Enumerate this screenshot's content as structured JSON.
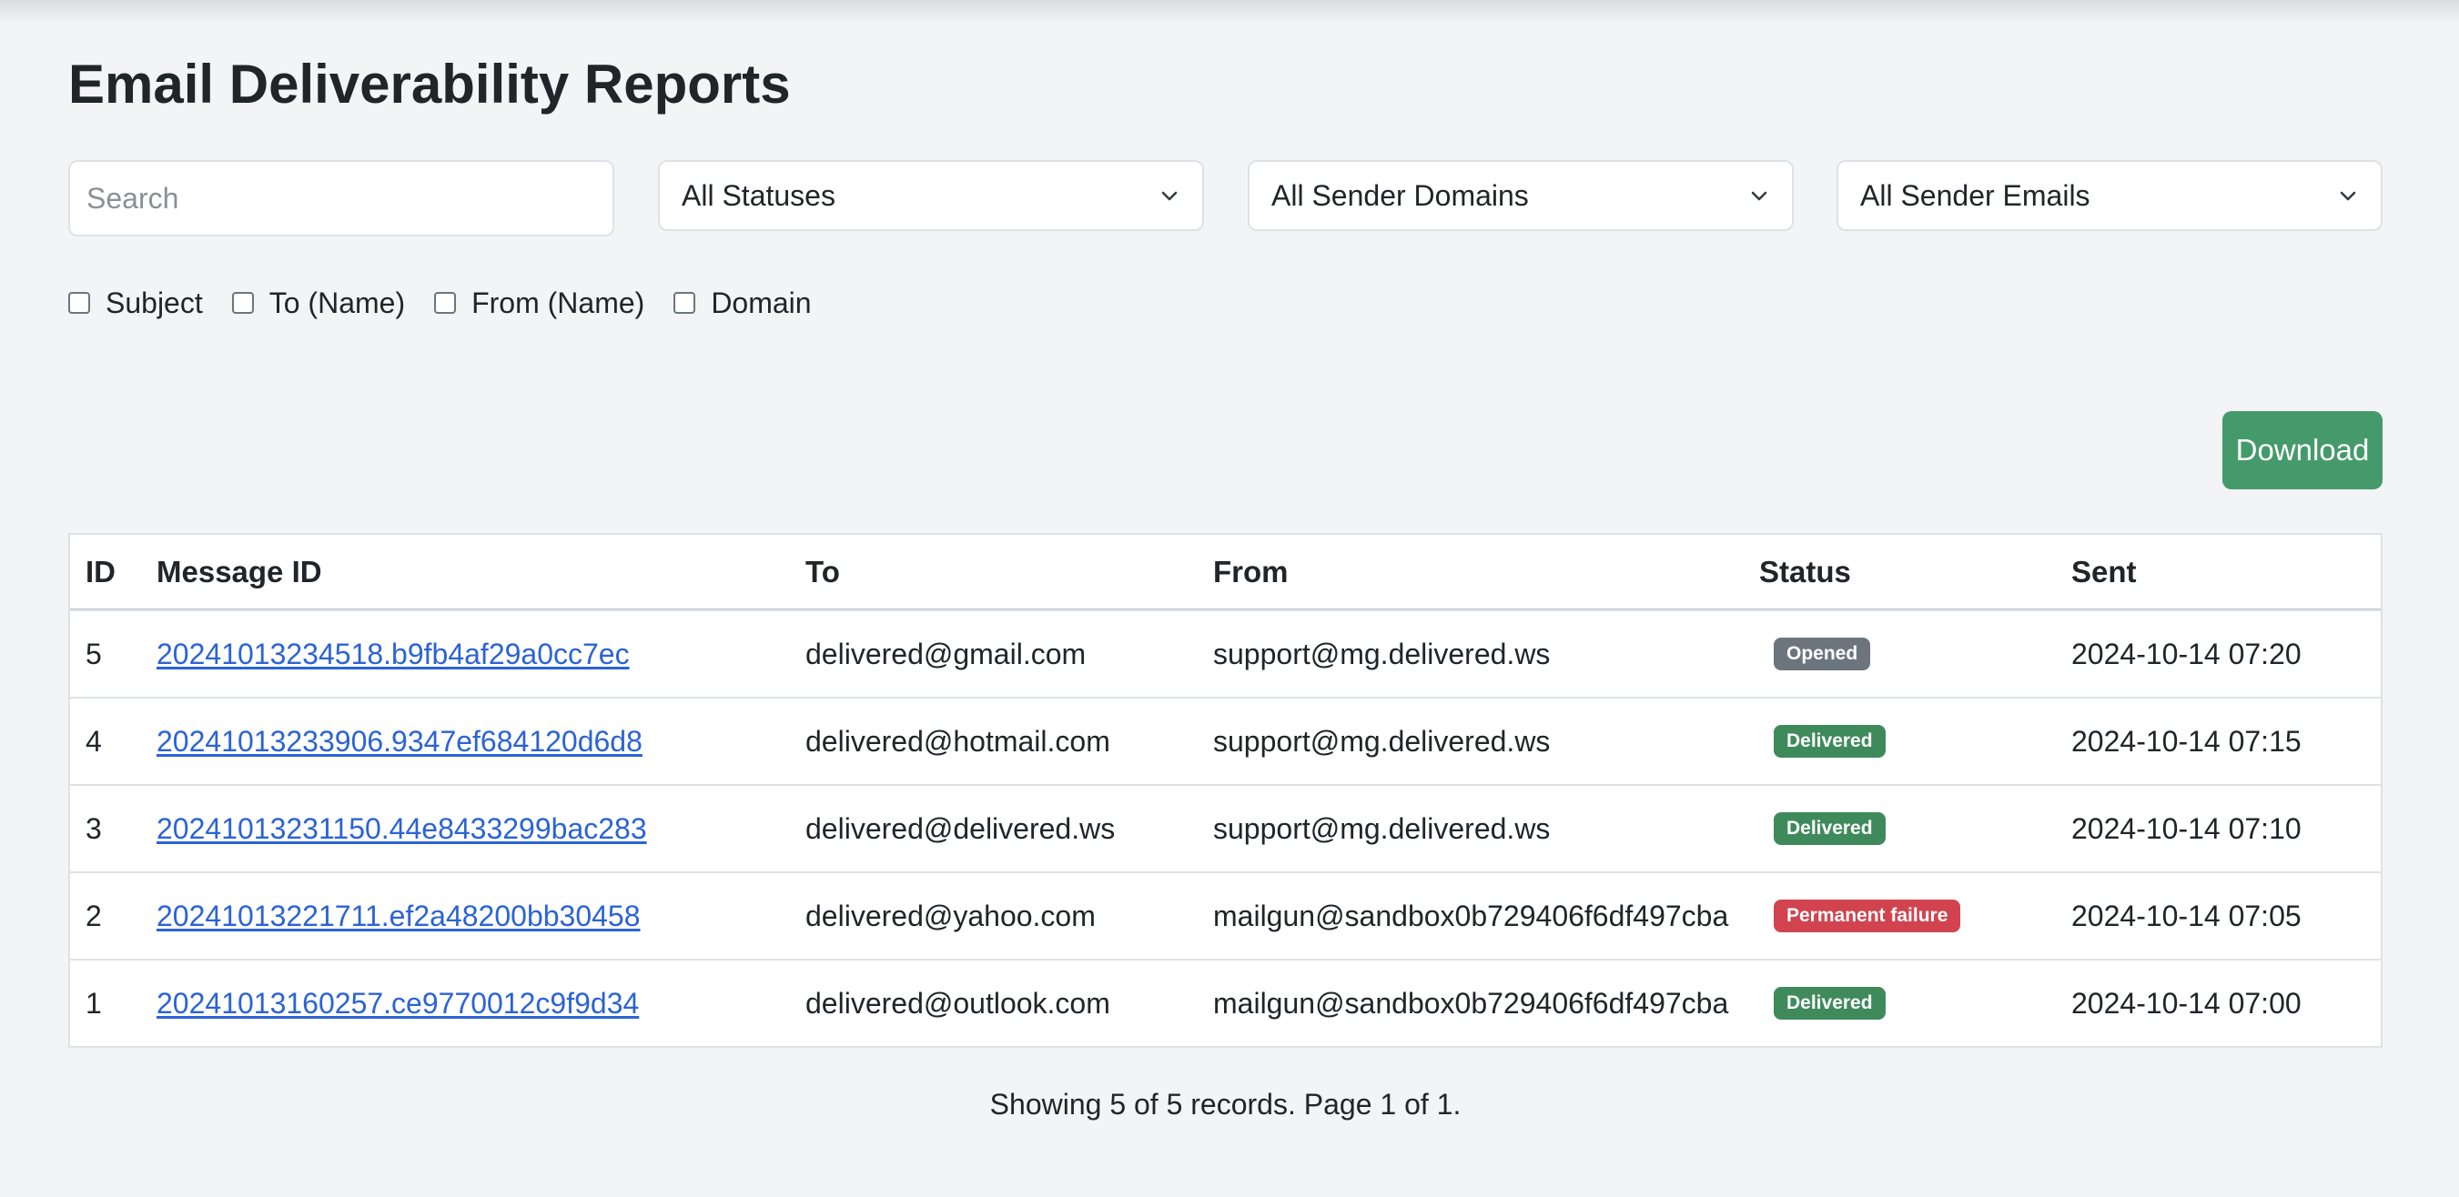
{
  "page": {
    "title": "Email Deliverability Reports"
  },
  "filters": {
    "search_placeholder": "Search",
    "search_value": "",
    "status_select": "All Statuses",
    "domain_select": "All Sender Domains",
    "email_select": "All Sender Emails",
    "checkboxes": [
      {
        "label": "Subject",
        "checked": false
      },
      {
        "label": "To (Name)",
        "checked": false
      },
      {
        "label": "From (Name)",
        "checked": false
      },
      {
        "label": "Domain",
        "checked": false
      }
    ]
  },
  "toolbar": {
    "download_label": "Download",
    "download_color": "#459a6b"
  },
  "table": {
    "headers": {
      "id": "ID",
      "message_id": "Message ID",
      "to": "To",
      "from": "From",
      "status": "Status",
      "sent": "Sent"
    },
    "rows": [
      {
        "id": "5",
        "message_id": "20241013234518.b9fb4af29a0cc7ec",
        "to": "delivered@gmail.com",
        "from": "support@mg.delivered.ws",
        "status": "Opened",
        "status_color": "#6c757d",
        "sent": "2024-10-14 07:20"
      },
      {
        "id": "4",
        "message_id": "20241013233906.9347ef684120d6d8",
        "to": "delivered@hotmail.com",
        "from": "support@mg.delivered.ws",
        "status": "Delivered",
        "status_color": "#3f8a5b",
        "sent": "2024-10-14 07:15"
      },
      {
        "id": "3",
        "message_id": "20241013231150.44e8433299bac283",
        "to": "delivered@delivered.ws",
        "from": "support@mg.delivered.ws",
        "status": "Delivered",
        "status_color": "#3f8a5b",
        "sent": "2024-10-14 07:10"
      },
      {
        "id": "2",
        "message_id": "20241013221711.ef2a48200bb30458",
        "to": "delivered@yahoo.com",
        "from": "mailgun@sandbox0b729406f6df497cba",
        "status": "Permanent failure",
        "status_color": "#d1434f",
        "sent": "2024-10-14 07:05"
      },
      {
        "id": "1",
        "message_id": "20241013160257.ce9770012c9f9d34",
        "to": "delivered@outlook.com",
        "from": "mailgun@sandbox0b729406f6df497cba",
        "status": "Delivered",
        "status_color": "#3f8a5b",
        "sent": "2024-10-14 07:00"
      }
    ]
  },
  "footer": {
    "summary": "Showing 5 of 5 records. Page 1 of 1."
  }
}
